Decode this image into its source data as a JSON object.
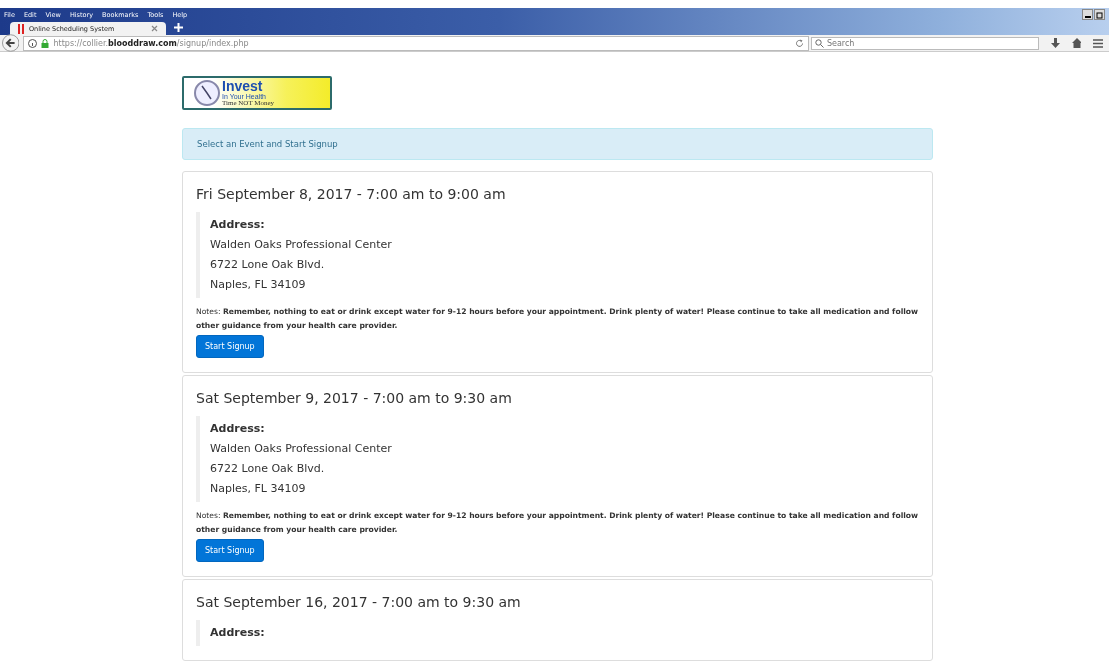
{
  "menu": [
    "File",
    "Edit",
    "View",
    "History",
    "Bookmarks",
    "Tools",
    "Help"
  ],
  "tabs": [
    {
      "label": "Online Scheduling System",
      "selected": true
    }
  ],
  "address_bar": {
    "prefix": "https://collier.",
    "domain": "blooddraw.com",
    "path": "/signup/index.php"
  },
  "search": {
    "placeholder": "Search"
  },
  "logo": {
    "title": "Invest",
    "subtitle": "In Your Health",
    "tagline": "Time NOT Money"
  },
  "alert": "Select an Event and Start Signup",
  "events": [
    {
      "title": "Fri September 8, 2017 - 7:00 am to 9:00 am",
      "address_label": "Address:",
      "address_lines": [
        "Walden Oaks Professional Center",
        "6722 Lone Oak Blvd.",
        "Naples, FL 34109"
      ],
      "notes_label": "Notes:",
      "notes": "Remember, nothing to eat or drink except water for 9-12 hours before your appointment. Drink plenty of water! Please continue to take all medication and follow other guidance from your health care provider.",
      "button": "Start Signup"
    },
    {
      "title": "Sat September 9, 2017 - 7:00 am to 9:30 am",
      "address_label": "Address:",
      "address_lines": [
        "Walden Oaks Professional Center",
        "6722 Lone Oak Blvd.",
        "Naples, FL 34109"
      ],
      "notes_label": "Notes:",
      "notes": "Remember, nothing to eat or drink except water for 9-12 hours before your appointment. Drink plenty of water! Please continue to take all medication and follow other guidance from your health care provider.",
      "button": "Start Signup"
    },
    {
      "title": "Sat September 16, 2017 - 7:00 am to 9:30 am",
      "address_label": "Address:"
    }
  ]
}
